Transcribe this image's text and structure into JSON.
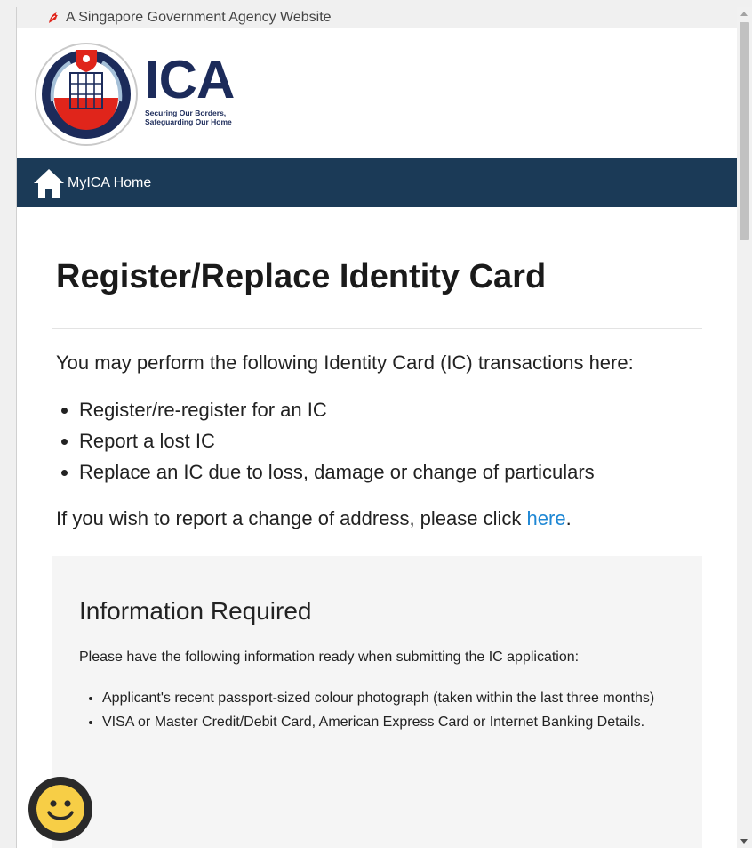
{
  "masthead": {
    "text": "A Singapore Government Agency Website"
  },
  "logo": {
    "name": "ICA",
    "tagline_line1": "Securing Our Borders,",
    "tagline_line2": "Safeguarding Our Home"
  },
  "nav": {
    "home_label": "MyICA Home"
  },
  "main": {
    "title": "Register/Replace Identity Card",
    "intro": "You may perform the following Identity Card (IC) transactions here:",
    "transactions": [
      "Register/re-register for an IC",
      "Report a lost IC",
      "Replace an IC due to loss, damage or change of particulars"
    ],
    "address_prefix": "If you wish to report a change of address, please click ",
    "address_link": "here",
    "address_suffix": "."
  },
  "info": {
    "heading": "Information Required",
    "lead": "Please have the following information ready when submitting the IC application:",
    "items": [
      "Applicant's recent passport-sized colour photograph (taken within the last three months)",
      "VISA or Master Credit/Debit Card, American Express Card or Internet Banking Details."
    ]
  },
  "colors": {
    "navbar": "#1b3a57",
    "link": "#1e87d4",
    "brand_navy": "#1c2b5a",
    "chat_face": "#f7ce46"
  },
  "icons": {
    "masthead": "singapore-lion-icon",
    "nav": "home-icon",
    "chat": "smiley-chat-icon"
  }
}
